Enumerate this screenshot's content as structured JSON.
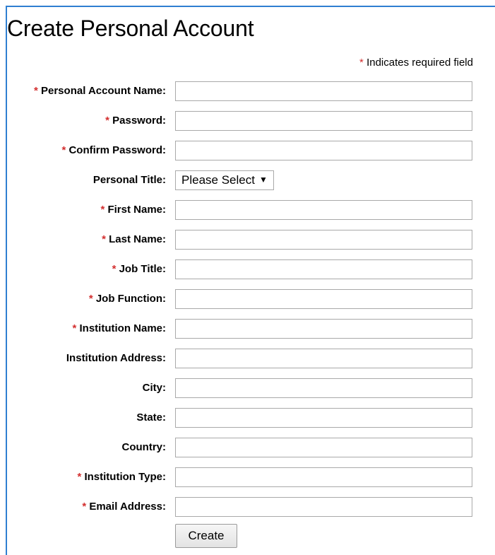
{
  "page": {
    "title": "Create Personal Account",
    "required_marker": "*",
    "required_note": "Indicates required field"
  },
  "form": {
    "fields": [
      {
        "label": "Personal Account Name:",
        "required": true,
        "type": "text",
        "value": ""
      },
      {
        "label": "Password:",
        "required": true,
        "type": "password",
        "value": ""
      },
      {
        "label": "Confirm Password:",
        "required": true,
        "type": "password",
        "value": ""
      },
      {
        "label": "Personal Title:",
        "required": false,
        "type": "select",
        "value": "Please Select"
      },
      {
        "label": "First Name:",
        "required": true,
        "type": "text",
        "value": ""
      },
      {
        "label": "Last Name:",
        "required": true,
        "type": "text",
        "value": ""
      },
      {
        "label": "Job Title:",
        "required": true,
        "type": "text",
        "value": ""
      },
      {
        "label": "Job Function:",
        "required": true,
        "type": "text",
        "value": ""
      },
      {
        "label": "Institution Name:",
        "required": true,
        "type": "text",
        "value": ""
      },
      {
        "label": "Institution Address:",
        "required": false,
        "type": "text",
        "value": ""
      },
      {
        "label": "City:",
        "required": false,
        "type": "text",
        "value": ""
      },
      {
        "label": "State:",
        "required": false,
        "type": "text",
        "value": ""
      },
      {
        "label": "Country:",
        "required": false,
        "type": "text",
        "value": ""
      },
      {
        "label": "Institution Type:",
        "required": true,
        "type": "text",
        "value": ""
      },
      {
        "label": "Email Address:",
        "required": true,
        "type": "text",
        "value": ""
      }
    ],
    "select_caret_icon": "caret-down-icon",
    "submit_label": "Create"
  },
  "colors": {
    "required_star": "#d32f2f",
    "frame_border": "#2f7fd1"
  }
}
